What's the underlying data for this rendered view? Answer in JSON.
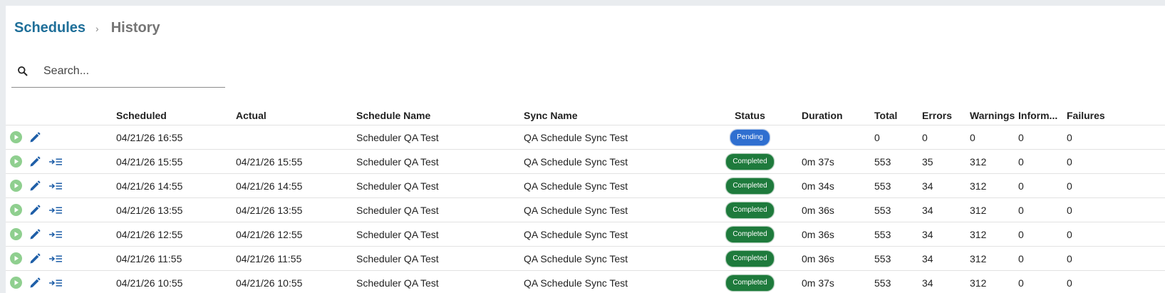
{
  "breadcrumb": {
    "parent": "Schedules",
    "current": "History",
    "separator": "›"
  },
  "search": {
    "placeholder": "Search...",
    "value": "",
    "icon": "search-icon"
  },
  "colors": {
    "link": "#1f6f99",
    "pending": "#2f6fd0",
    "completed": "#1e7a3c",
    "play": "#8fcf8f",
    "action_icon": "#1f5fa8"
  },
  "table": {
    "columns": [
      "",
      "Scheduled",
      "Actual",
      "Schedule Name",
      "Sync Name",
      "Status",
      "Duration",
      "Total",
      "Errors",
      "Warnings",
      "Inform...",
      "Failures"
    ],
    "rows": [
      {
        "scheduled": "04/21/26 16:55",
        "actual": "",
        "schedule_name": "Scheduler QA Test",
        "sync_name": "QA Schedule Sync Test",
        "status": "Pending",
        "duration": "",
        "total": "0",
        "errors": "0",
        "warnings": "0",
        "informational": "0",
        "failures": "0",
        "has_log": false
      },
      {
        "scheduled": "04/21/26 15:55",
        "actual": "04/21/26 15:55",
        "schedule_name": "Scheduler QA Test",
        "sync_name": "QA Schedule Sync Test",
        "status": "Completed",
        "duration": "0m 37s",
        "total": "553",
        "errors": "35",
        "warnings": "312",
        "informational": "0",
        "failures": "0",
        "has_log": true
      },
      {
        "scheduled": "04/21/26 14:55",
        "actual": "04/21/26 14:55",
        "schedule_name": "Scheduler QA Test",
        "sync_name": "QA Schedule Sync Test",
        "status": "Completed",
        "duration": "0m 34s",
        "total": "553",
        "errors": "34",
        "warnings": "312",
        "informational": "0",
        "failures": "0",
        "has_log": true
      },
      {
        "scheduled": "04/21/26 13:55",
        "actual": "04/21/26 13:55",
        "schedule_name": "Scheduler QA Test",
        "sync_name": "QA Schedule Sync Test",
        "status": "Completed",
        "duration": "0m 36s",
        "total": "553",
        "errors": "34",
        "warnings": "312",
        "informational": "0",
        "failures": "0",
        "has_log": true
      },
      {
        "scheduled": "04/21/26 12:55",
        "actual": "04/21/26 12:55",
        "schedule_name": "Scheduler QA Test",
        "sync_name": "QA Schedule Sync Test",
        "status": "Completed",
        "duration": "0m 36s",
        "total": "553",
        "errors": "34",
        "warnings": "312",
        "informational": "0",
        "failures": "0",
        "has_log": true
      },
      {
        "scheduled": "04/21/26 11:55",
        "actual": "04/21/26 11:55",
        "schedule_name": "Scheduler QA Test",
        "sync_name": "QA Schedule Sync Test",
        "status": "Completed",
        "duration": "0m 36s",
        "total": "553",
        "errors": "34",
        "warnings": "312",
        "informational": "0",
        "failures": "0",
        "has_log": true
      },
      {
        "scheduled": "04/21/26 10:55",
        "actual": "04/21/26 10:55",
        "schedule_name": "Scheduler QA Test",
        "sync_name": "QA Schedule Sync Test",
        "status": "Completed",
        "duration": "0m 37s",
        "total": "553",
        "errors": "34",
        "warnings": "312",
        "informational": "0",
        "failures": "0",
        "has_log": true
      }
    ]
  }
}
